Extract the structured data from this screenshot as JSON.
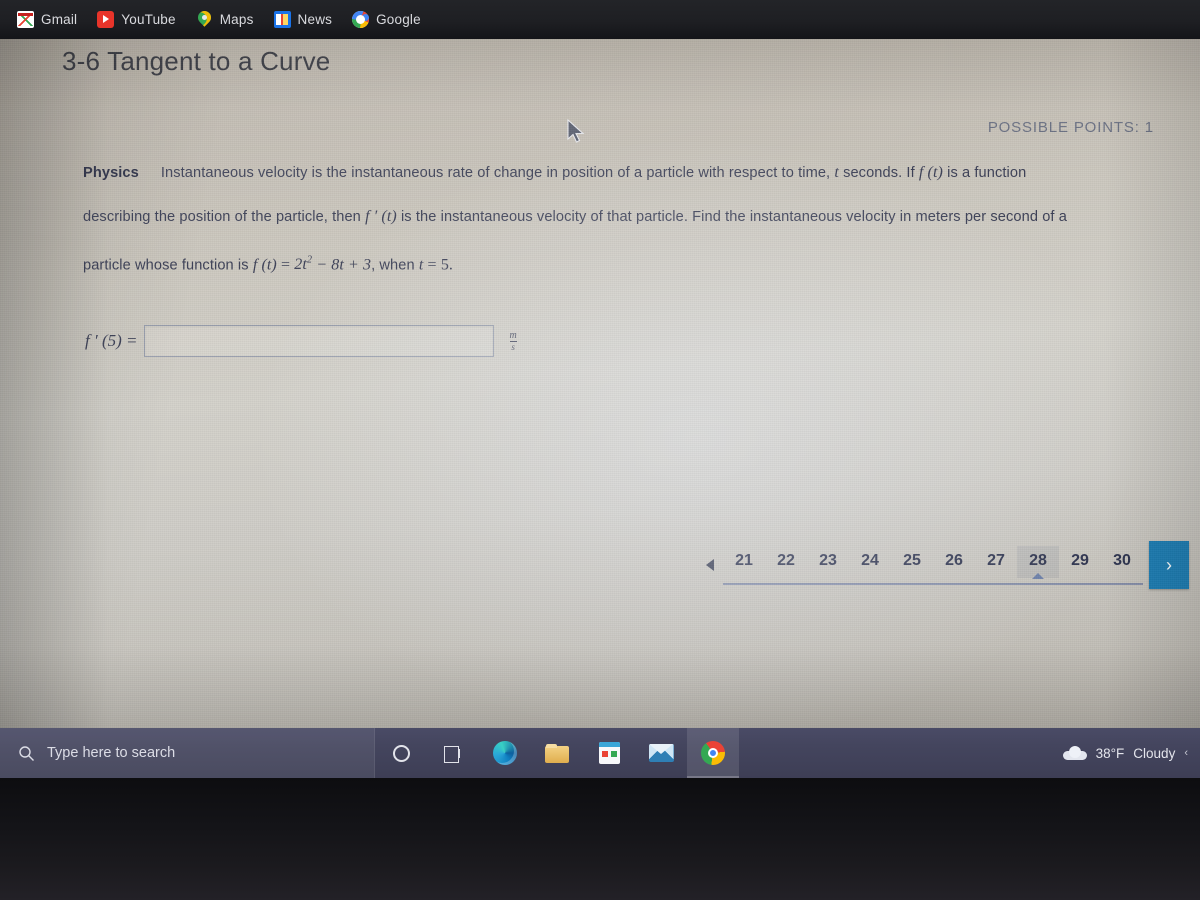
{
  "browser": {
    "bookmarks": [
      {
        "label": "Gmail",
        "icon": "gmail-icon"
      },
      {
        "label": "YouTube",
        "icon": "youtube-icon"
      },
      {
        "label": "Maps",
        "icon": "maps-icon"
      },
      {
        "label": "News",
        "icon": "google-news-icon"
      },
      {
        "label": "Google",
        "icon": "google-icon"
      }
    ]
  },
  "assignment": {
    "title": "3-6 Tangent to a Curve",
    "possible_points": "POSSIBLE POINTS: 1",
    "subject": "Physics",
    "line1_a": "Instantaneous velocity is the instantaneous rate of change in position of a particle with respect to time,",
    "line1_t": "t",
    "line1_b": "seconds.  If",
    "line1_f": "f (t)",
    "line1_c": "is a function",
    "line2_a": "describing the position of the particle, then",
    "line2_f": "f ′ (t)",
    "line2_b": "is the instantaneous velocity of that particle.  Find the instantaneous velocity in meters per second of a",
    "line3_a": "particle whose function is",
    "line3_eq_f": "f (t)",
    "line3_eq_rest": "2t",
    "line3_eq_exp": "2",
    "line3_eq_tail": "− 8t + 3",
    "line3_b": ", when",
    "line3_t": "t",
    "line3_val": "5.",
    "answer_label": "f ′ (5) =",
    "answer_value": "",
    "answer_placeholder": "",
    "unit_numerator": "m",
    "unit_denominator": "s"
  },
  "pagination": {
    "prev_icon": "triangle-left-icon",
    "pages": [
      "21",
      "22",
      "23",
      "24",
      "25",
      "26",
      "27",
      "28",
      "29",
      "30"
    ],
    "active_page": "28",
    "next_label": "›",
    "accent_color": "#1f7fb5"
  },
  "taskbar": {
    "search_placeholder": "Type here to search",
    "search_icon": "search-icon",
    "buttons": [
      {
        "name": "cortana-button",
        "icon": "cortana-icon",
        "active": false
      },
      {
        "name": "task-view-button",
        "icon": "task-view-icon",
        "active": false
      },
      {
        "name": "edge-button",
        "icon": "edge-icon",
        "active": false
      },
      {
        "name": "file-explorer-button",
        "icon": "folder-icon",
        "active": false
      },
      {
        "name": "microsoft-store-button",
        "icon": "store-icon",
        "active": false
      },
      {
        "name": "mail-button",
        "icon": "mail-icon",
        "active": false
      },
      {
        "name": "chrome-button",
        "icon": "chrome-icon",
        "active": true
      }
    ],
    "weather_temp": "38°F",
    "weather_condition": "Cloudy",
    "weather_icon": "cloud-icon",
    "tray_arrow": "‹"
  }
}
